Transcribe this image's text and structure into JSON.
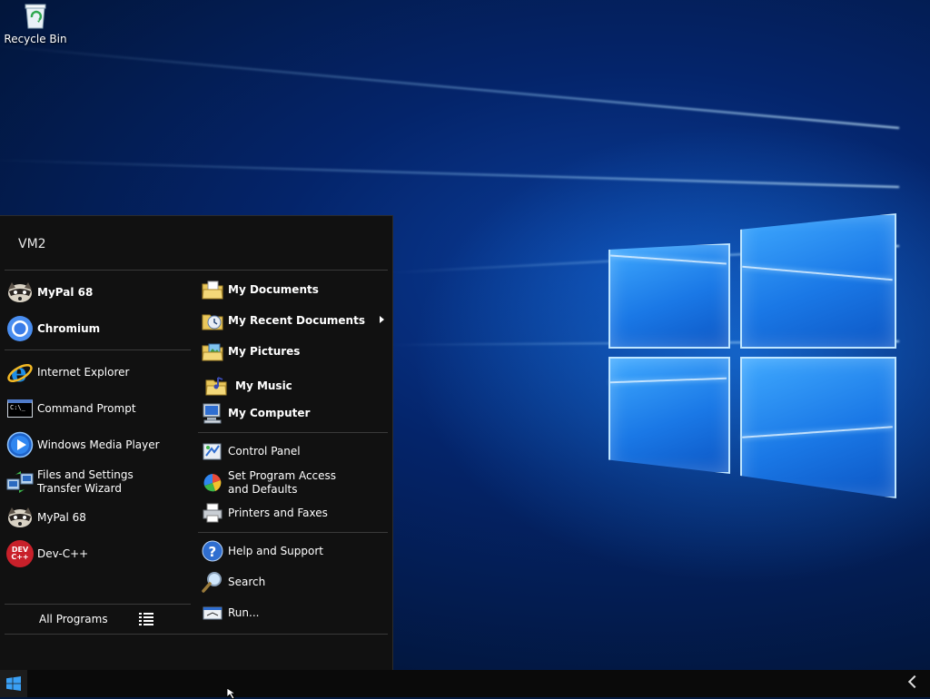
{
  "desktop": {
    "icons": [
      {
        "label": "Recycle Bin",
        "icon": "recycle-bin-icon"
      }
    ]
  },
  "start_menu": {
    "user_name": "VM2",
    "pinned": [
      {
        "label": "MyPal 68",
        "icon": "mypal-icon"
      },
      {
        "label": "Chromium",
        "icon": "chromium-icon"
      }
    ],
    "recent_programs": [
      {
        "label": "Internet Explorer",
        "icon": "internet-explorer-icon"
      },
      {
        "label": "Command Prompt",
        "icon": "command-prompt-icon",
        "icon_text": "C:\\_"
      },
      {
        "label": "Windows Media Player",
        "icon": "media-player-icon"
      },
      {
        "label": "Files and Settings Transfer Wizard",
        "icon": "transfer-wizard-icon"
      },
      {
        "label": "MyPal 68",
        "icon": "mypal-icon"
      },
      {
        "label": "Dev-C++",
        "icon": "devcpp-icon",
        "icon_text": "DEV C++"
      }
    ],
    "all_programs_label": "All Programs",
    "places": [
      {
        "label": "My Documents",
        "icon": "documents-folder-icon"
      },
      {
        "label": "My Recent Documents",
        "icon": "recent-documents-icon",
        "has_submenu": true
      },
      {
        "label": "My Pictures",
        "icon": "pictures-folder-icon"
      },
      {
        "label": "My Music",
        "icon": "music-folder-icon"
      },
      {
        "label": "My Computer",
        "icon": "computer-icon"
      }
    ],
    "system": [
      {
        "label": "Control Panel",
        "icon": "control-panel-icon"
      },
      {
        "label": "Set Program Access and Defaults",
        "icon": "program-defaults-icon"
      },
      {
        "label": "Printers and Faxes",
        "icon": "printer-icon"
      }
    ],
    "help": [
      {
        "label": "Help and Support",
        "icon": "help-icon"
      },
      {
        "label": "Search",
        "icon": "search-icon"
      },
      {
        "label": "Run...",
        "icon": "run-icon"
      }
    ]
  },
  "taskbar": {
    "start_icon": "windows-logo-icon",
    "tray_icon": "chevron-left-icon"
  },
  "colors": {
    "menu_bg": "#111111",
    "separator": "#3a3a3a",
    "wallpaper_glow": "#3fa9ff",
    "taskbar_bg": "#0a0a0a"
  }
}
